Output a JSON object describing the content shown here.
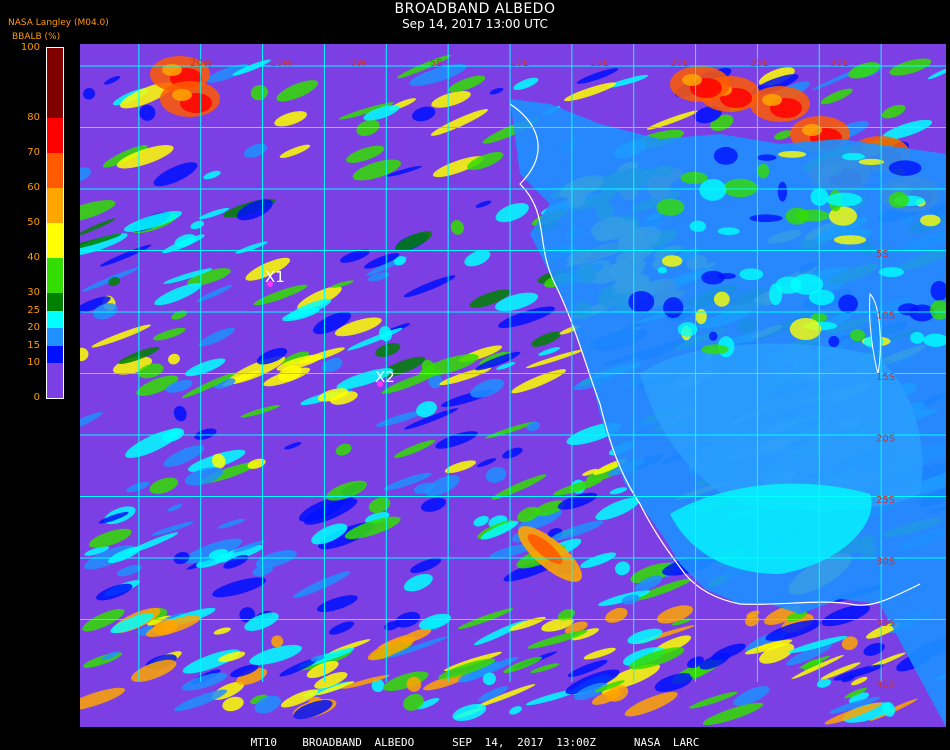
{
  "header": {
    "title": "BROADBAND ALBEDO",
    "datetime": "Sep 14, 2017 13:00 UTC",
    "source": "NASA Langley (M04.0)"
  },
  "legend": {
    "title": "BBALB (%)",
    "ticks": [
      "100",
      "80",
      "70",
      "60",
      "50",
      "40",
      "30",
      "25",
      "20",
      "15",
      "10",
      "0"
    ],
    "bins": [
      {
        "from": 0,
        "to": 10,
        "color": "#7b3fe4"
      },
      {
        "from": 10,
        "to": 15,
        "color": "#0010ff"
      },
      {
        "from": 15,
        "to": 20,
        "color": "#1e90ff"
      },
      {
        "from": 20,
        "to": 25,
        "color": "#00ffff"
      },
      {
        "from": 25,
        "to": 30,
        "color": "#008000"
      },
      {
        "from": 30,
        "to": 40,
        "color": "#33dd00"
      },
      {
        "from": 40,
        "to": 50,
        "color": "#ffff00"
      },
      {
        "from": 50,
        "to": 60,
        "color": "#ffa500"
      },
      {
        "from": 60,
        "to": 70,
        "color": "#ff5a00"
      },
      {
        "from": 70,
        "to": 80,
        "color": "#ff0000"
      },
      {
        "from": 80,
        "to": 100,
        "color": "#800000"
      }
    ]
  },
  "map": {
    "grid_color": "#00ffff",
    "markers": [
      {
        "label": "X1"
      },
      {
        "label": "X2"
      }
    ],
    "lat_labels": [
      "5S",
      "10S",
      "15S",
      "20S",
      "25S",
      "30S",
      "35S",
      "40S"
    ],
    "lon_labels": [
      "20W",
      "10W",
      "0W",
      "5E",
      "10E",
      "15E",
      "20E",
      "25E",
      "30E"
    ]
  },
  "footer": {
    "text": "MT10  BROADBAND ALBEDO   SEP 14, 2017 13:00Z   NASA LARC"
  }
}
